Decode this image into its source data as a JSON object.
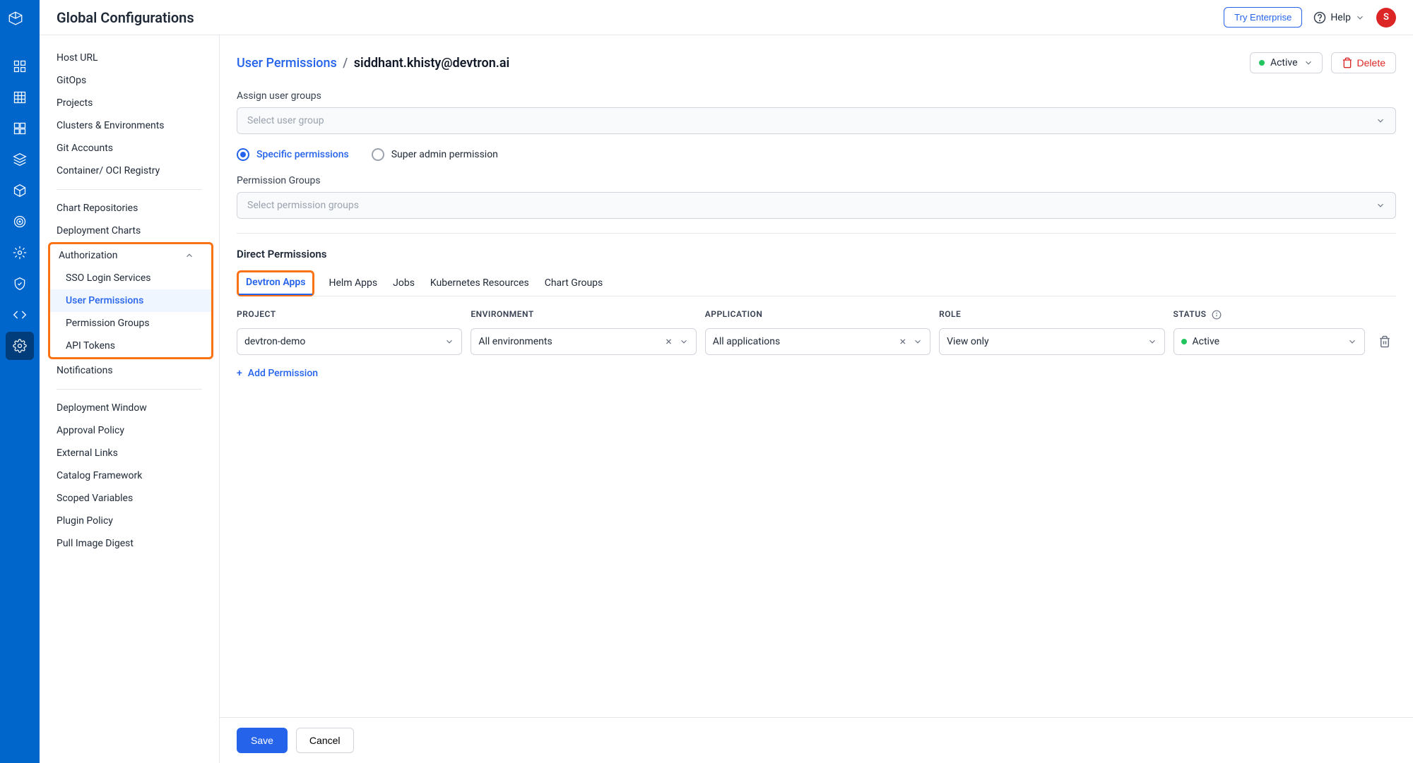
{
  "header": {
    "title": "Global Configurations",
    "try_enterprise": "Try Enterprise",
    "help": "Help",
    "avatar_initial": "S"
  },
  "sidebar": {
    "items_top": [
      "Host URL",
      "GitOps",
      "Projects",
      "Clusters & Environments",
      "Git Accounts",
      "Container/ OCI Registry"
    ],
    "items_mid": [
      "Chart Repositories",
      "Deployment Charts"
    ],
    "auth_label": "Authorization",
    "auth_children": [
      "SSO Login Services",
      "User Permissions",
      "Permission Groups",
      "API Tokens"
    ],
    "items_after_auth": [
      "Notifications"
    ],
    "items_bottom": [
      "Deployment Window",
      "Approval Policy",
      "External Links",
      "Catalog Framework",
      "Scoped Variables",
      "Plugin Policy",
      "Pull Image Digest"
    ]
  },
  "breadcrumb": {
    "parent": "User Permissions",
    "current": "siddhant.khisty@devtron.ai"
  },
  "status_pill": "Active",
  "delete_btn": "Delete",
  "assign_groups": {
    "label": "Assign user groups",
    "placeholder": "Select user group"
  },
  "permission_type": {
    "specific": "Specific permissions",
    "super": "Super admin permission"
  },
  "permission_groups": {
    "label": "Permission Groups",
    "placeholder": "Select permission groups"
  },
  "direct_permissions": {
    "title": "Direct Permissions",
    "tabs": [
      "Devtron Apps",
      "Helm Apps",
      "Jobs",
      "Kubernetes Resources",
      "Chart Groups"
    ],
    "columns": {
      "project": "PROJECT",
      "environment": "ENVIRONMENT",
      "application": "APPLICATION",
      "role": "ROLE",
      "status": "STATUS"
    },
    "row": {
      "project": "devtron-demo",
      "environment": "All environments",
      "application": "All applications",
      "role": "View only",
      "status": "Active"
    },
    "add_permission": "Add Permission"
  },
  "footer": {
    "save": "Save",
    "cancel": "Cancel"
  }
}
